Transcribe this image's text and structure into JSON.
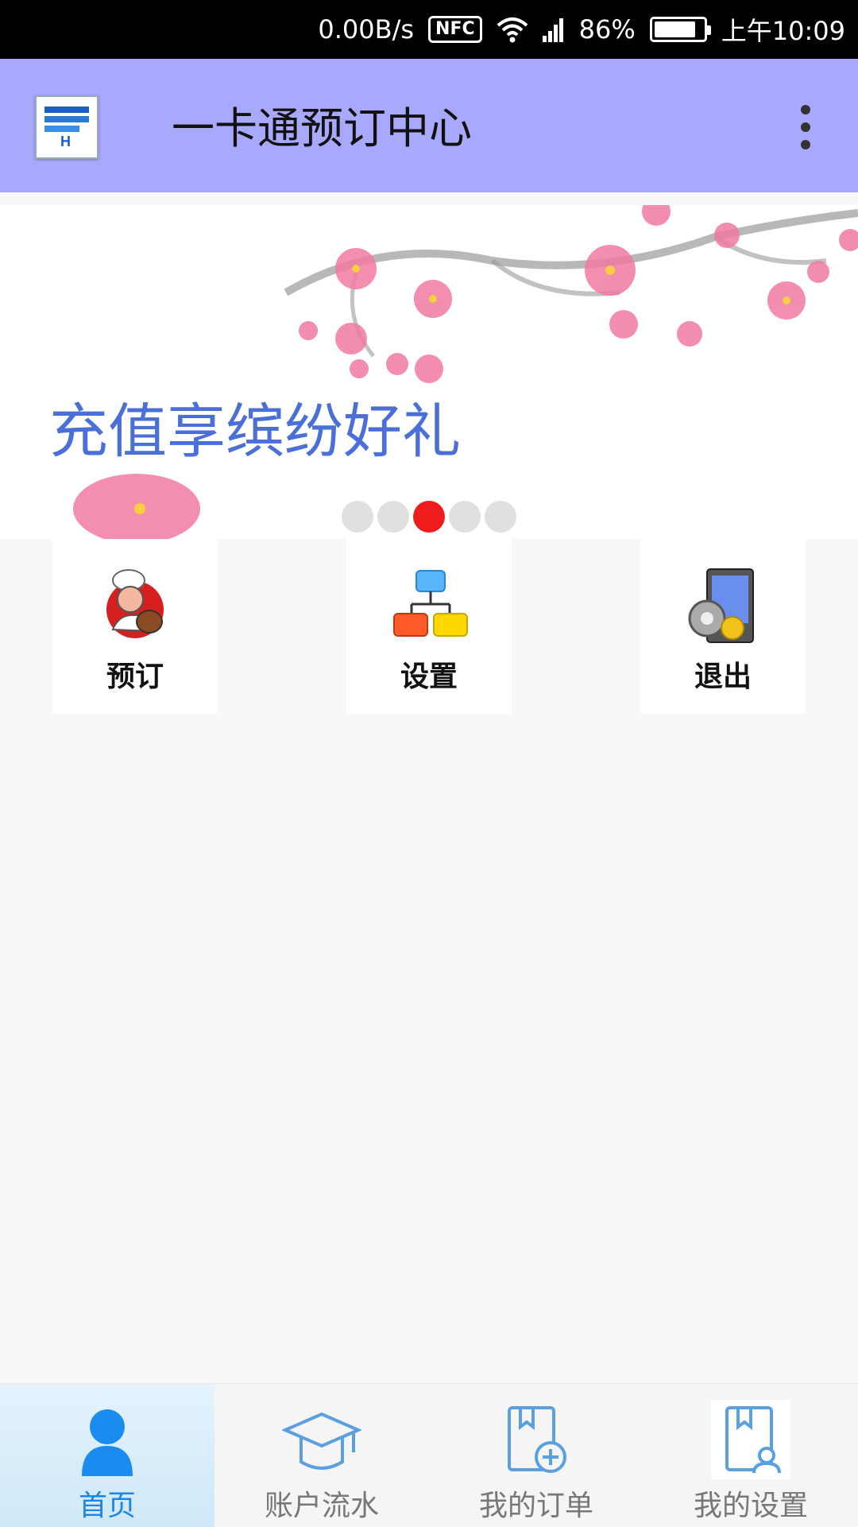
{
  "status_bar": {
    "net_speed": "0.00B/s",
    "nfc": "NFC",
    "battery": "86%",
    "battery_level": 0.86,
    "time": "上午10:09",
    "icons": [
      "nfc-icon",
      "wifi-icon",
      "signal-icon",
      "battery-icon"
    ]
  },
  "app_bar": {
    "title": "一卡通预订中心",
    "logo_icon": "app-logo-icon",
    "menu_icon": "overflow-menu-icon"
  },
  "banner": {
    "text": "充值享缤纷好礼",
    "active_slide": 3,
    "slide_count": 5,
    "accent_color": "#ee1c1c"
  },
  "tiles": [
    {
      "label": "预订",
      "icon": "chef-icon"
    },
    {
      "label": "设置",
      "icon": "hierarchy-icon"
    },
    {
      "label": "退出",
      "icon": "exit-device-icon"
    }
  ],
  "bottom_nav": {
    "active_color": "#1a86e8",
    "tabs": [
      {
        "label": "首页",
        "icon": "person-icon",
        "active": true
      },
      {
        "label": "账户流水",
        "icon": "graduation-cap-icon",
        "active": false
      },
      {
        "label": "我的订单",
        "icon": "book-add-icon",
        "active": false
      },
      {
        "label": "我的设置",
        "icon": "book-user-icon",
        "active": false
      }
    ]
  }
}
